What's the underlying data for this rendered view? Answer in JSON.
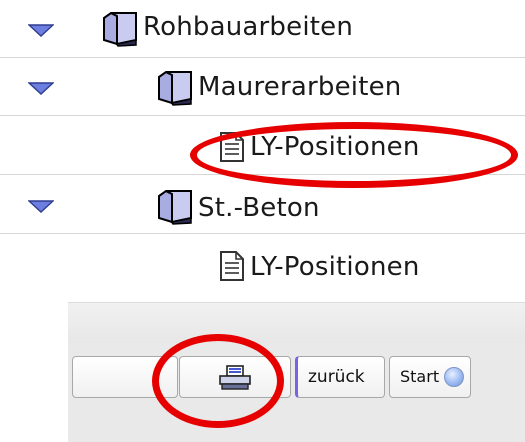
{
  "tree": {
    "items": [
      {
        "label": "Rohbauarbeiten",
        "expanded": true,
        "icon": "folder-icon"
      },
      {
        "label": "Maurerarbeiten",
        "expanded": true,
        "icon": "folder-icon"
      },
      {
        "label": "LY-Positionen",
        "icon": "document-icon"
      },
      {
        "label": "St.-Beton",
        "expanded": true,
        "icon": "folder-icon"
      },
      {
        "label": "LY-Positionen",
        "icon": "document-icon"
      }
    ]
  },
  "toolbar": {
    "back_label": "zurück",
    "start_label": "Start",
    "print_icon": "printer-icon"
  },
  "colors": {
    "expander": "#5a6ecf",
    "folder": "#b9bde8",
    "annotation": "#e60000"
  }
}
